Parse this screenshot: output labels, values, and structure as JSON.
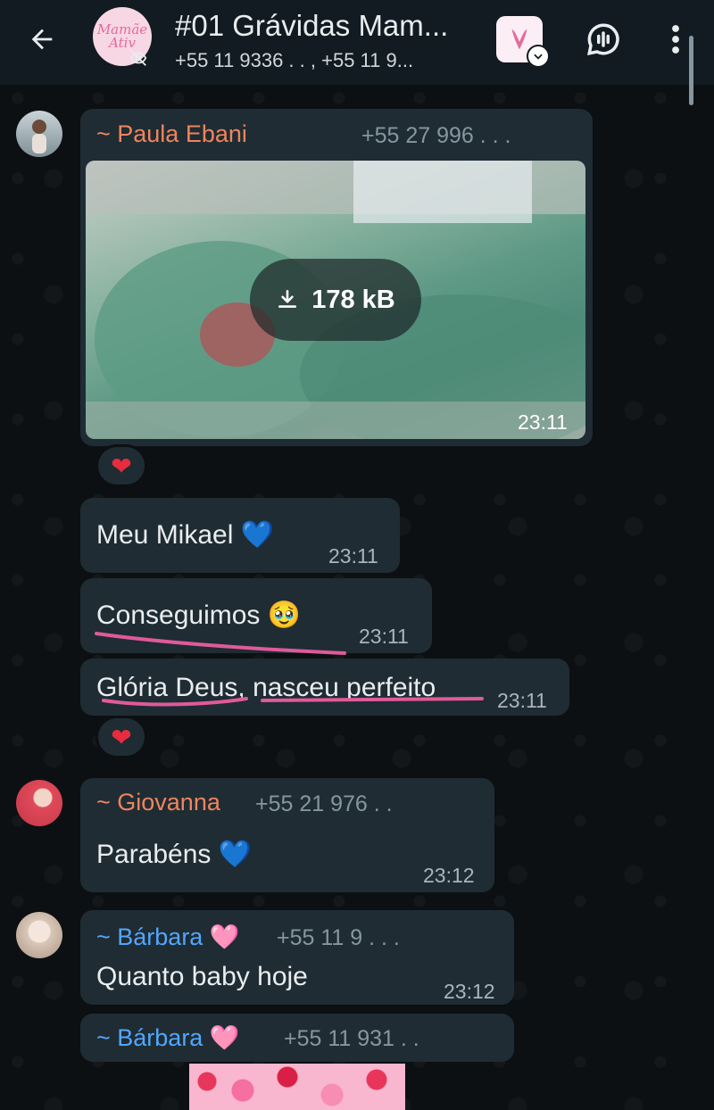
{
  "header": {
    "title": "#01 Grávidas Mam...",
    "subtitle": "+55 11 9336 .  .  , +55 11 9...",
    "group_avatar_text_line1": "Mamãe",
    "group_avatar_text_line2": "Ativ",
    "icons": {
      "back": "arrow-left-icon",
      "mute": "eye-off-icon",
      "voice_chat": "voice-chat-icon",
      "menu": "more-vert-icon"
    }
  },
  "messages": [
    {
      "sender": "~ Paula Ebani",
      "sender_color": "#f0845c",
      "phone": "+55 27 996 .  .  .",
      "media": {
        "type": "photo",
        "download_size": "178 kB",
        "time": "23:11"
      },
      "reaction": "❤️"
    },
    {
      "text": "Meu Mikael 💙",
      "time": "23:11"
    },
    {
      "text": "Conseguimos 🥹",
      "time": "23:11"
    },
    {
      "text": "Glória Deus, nasceu perfeito",
      "time": "23:11",
      "reaction": "❤️"
    },
    {
      "sender": "~ Giovanna",
      "sender_color": "#f0845c",
      "phone": "+55 21 976 .  .",
      "text": "Parabéns 💙",
      "time": "23:12"
    },
    {
      "sender": "~ Bárbara 🩷",
      "sender_color": "#53a6fd",
      "phone": "+55 11 9 .  .  .",
      "text": "Quanto baby hoje",
      "time": "23:12"
    },
    {
      "sender": "~ Bárbara 🩷",
      "sender_color": "#53a6fd",
      "phone": "+55 11 931 .  ."
    }
  ],
  "colors": {
    "header_bg": "#111b21",
    "bubble_bg": "#1f2c34",
    "wallpaper": "#0c1013",
    "highlight_underline": "#e05a9a"
  }
}
